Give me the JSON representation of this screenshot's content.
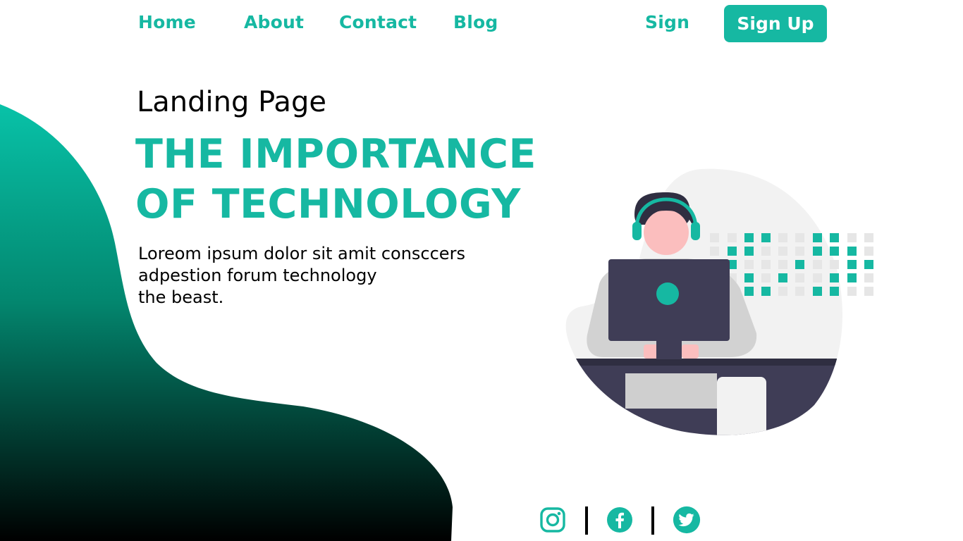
{
  "nav": {
    "items": [
      {
        "label": "Home"
      },
      {
        "label": "About"
      },
      {
        "label": "Contact"
      },
      {
        "label": "Blog"
      }
    ],
    "sign_label": "Sign",
    "signup_label": "Sign Up"
  },
  "hero": {
    "subtitle": "Landing Page",
    "headline": [
      "THE IMPORTANCE",
      "OF TECHNOLOGY"
    ],
    "description": [
      "Loreom ipsum dolor sit amit consccers",
      "adpestion forum technology",
      "the beast."
    ]
  },
  "social": {
    "icons": [
      "instagram-icon",
      "facebook-icon",
      "twitter-icon"
    ]
  },
  "colors": {
    "accent": "#16b8a2",
    "blob_top": "#08c2a8",
    "blob_bottom": "#000000",
    "dark": "#3f3d56",
    "skin": "#fbbebe"
  }
}
